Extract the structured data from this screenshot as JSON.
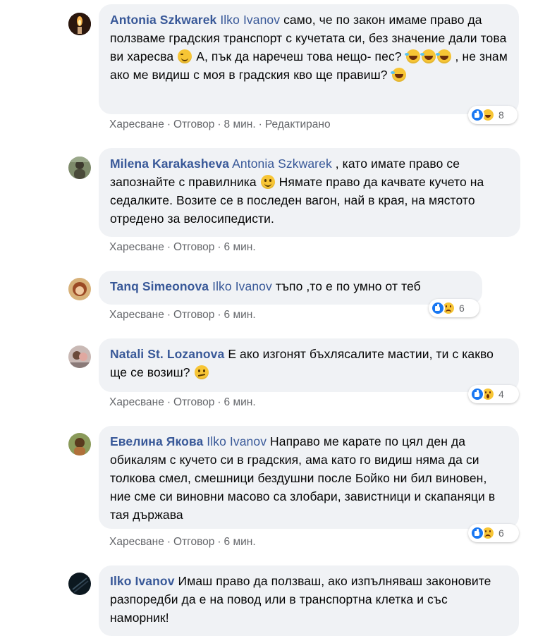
{
  "comments": [
    {
      "author": "Antonia Szkwarek",
      "mention": "Ilko Ivanov",
      "text1": " само, че по закон имаме право да ползваме градския транспорт с кучетата си, без значение дали това ви харесва ",
      "text2": " А, пък да наречеш това нещо- пес? ",
      "text3": " , не знам ако ме видиш с моя в градския кво ще правиш? ",
      "like": "Харесване",
      "reply": "Отговор",
      "time": "8 мин.",
      "edited": "Редактирано",
      "reactions": {
        "count": "8",
        "types": [
          "like",
          "haha"
        ]
      }
    },
    {
      "author": "Milena Karakasheva",
      "mention": "Antonia Szkwarek",
      "text1": " , като имате право се запознайте с правилника ",
      "text2": " Нямате право да качвате кучето на седалките. Возите се в последен вагон, най в края, на мястото отредено за велосипедисти.",
      "like": "Харесване",
      "reply": "Отговор",
      "time": "6 мин."
    },
    {
      "author": "Tanq Simeonova",
      "mention": "Ilko Ivanov",
      "text1": " тъпо ,то е по умно от теб",
      "like": "Харесване",
      "reply": "Отговор",
      "time": "6 мин.",
      "reactions": {
        "count": "6",
        "types": [
          "like",
          "sad"
        ]
      }
    },
    {
      "author": "Natali St. Lozanova",
      "text1": " Е ако изгонят бъхлясалите мастии, ти с какво ще се возиш? ",
      "like": "Харесване",
      "reply": "Отговор",
      "time": "6 мин.",
      "reactions": {
        "count": "4",
        "types": [
          "like",
          "wow"
        ]
      }
    },
    {
      "author": "Евелина Якова",
      "mention": "Ilko Ivanov",
      "text1": " Направо ме карате по цял ден да обикалям с кучето си в градския, ама като го видиш няма да си толкова смел, смешници бездушни после Бойко ни бил виновен, ние сме си виновни масово са злобари, завистници и скапаняци в тая държава",
      "like": "Харесване",
      "reply": "Отговор",
      "time": "6 мин.",
      "reactions": {
        "count": "6",
        "types": [
          "like",
          "sad"
        ]
      }
    },
    {
      "author": "Ilko Ivanov",
      "text1": " Имаш право да ползваш, ако изпълняваш законовите разпоредби да е на повод или в транспортна клетка и със наморник!"
    }
  ],
  "colors": {
    "link": "#385898",
    "bubble": "#f0f2f5",
    "meta": "#65676b",
    "like_blue": "#1877f2"
  }
}
